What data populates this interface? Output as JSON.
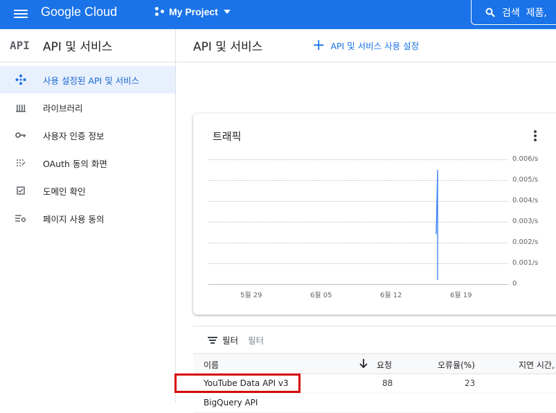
{
  "topbar": {
    "brand": "Google Cloud",
    "project": "My Project",
    "search_label": "검색  제품,"
  },
  "sidebar": {
    "logo": "API",
    "title": "API 및 서비스",
    "items": [
      {
        "label": "사용 설정된 API 및 서비스",
        "icon": "diamond-dots-icon",
        "active": true
      },
      {
        "label": "라이브러리",
        "icon": "library-icon"
      },
      {
        "label": "사용자 인증 정보",
        "icon": "key-icon"
      },
      {
        "label": "OAuth 동의 화면",
        "icon": "dotted-grid-icon"
      },
      {
        "label": "도메인 확인",
        "icon": "checkbox-icon"
      },
      {
        "label": "페이지 사용 동의",
        "icon": "list-settings-icon"
      }
    ]
  },
  "main": {
    "title": "API 및 서비스",
    "add_label": "API 및 서비스 사용 설정"
  },
  "traffic": {
    "title": "트래픽",
    "y_ticks": [
      "0.006/s",
      "0.005/s",
      "0.004/s",
      "0.003/s",
      "0.002/s",
      "0.001/s",
      "0"
    ],
    "x_ticks": [
      "5월 29",
      "6월 05",
      "6월 12",
      "6월 19"
    ]
  },
  "chart_data": {
    "type": "line",
    "title": "트래픽",
    "ylim": [
      0,
      0.006
    ],
    "y_ticks": [
      0,
      0.001,
      0.002,
      0.003,
      0.004,
      0.005,
      0.006
    ],
    "x_ticks": [
      "5월 29",
      "6월 05",
      "6월 12",
      "6월 19"
    ],
    "series": [
      {
        "x": [
          "6월 16",
          "6월 16",
          "6월 16"
        ],
        "values": [
          0.0024,
          0.0055,
          0.0002
        ],
        "color": "#4285f4"
      }
    ],
    "grid": true
  },
  "table": {
    "filter_label": "필터",
    "filter_placeholder": "필터",
    "headers": [
      "이름",
      "요청",
      "오류율(%)",
      "지연 시간,"
    ],
    "rows": [
      {
        "name": "YouTube Data API v3",
        "requests": "88",
        "errors": "23",
        "latency": ""
      },
      {
        "name": "BigQuery API",
        "requests": "",
        "errors": "",
        "latency": ""
      }
    ]
  },
  "colors": {
    "accent": "#1a73e8",
    "highlight": "#d50000",
    "line": "#4285f4"
  }
}
